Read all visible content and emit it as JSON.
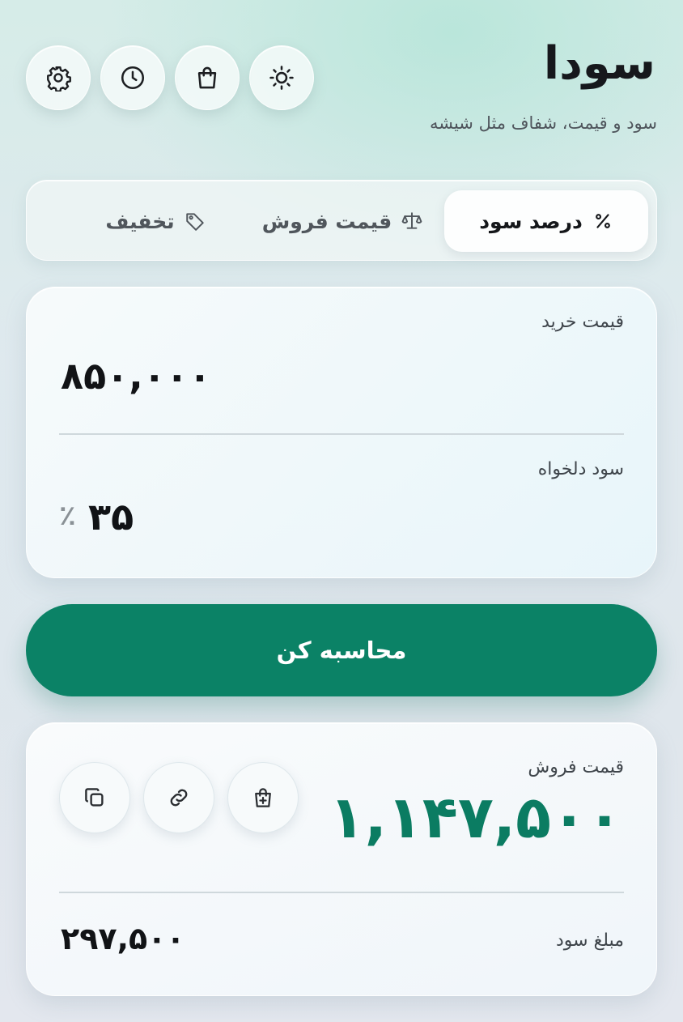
{
  "header": {
    "title": "سودا",
    "subtitle": "سود و قیمت، شفاف مثل شیشه",
    "icons": [
      "sun-icon",
      "shopping-bag-icon",
      "clock-icon",
      "gear-icon"
    ]
  },
  "tabs": [
    {
      "label": "درصد سود",
      "icon": "percent-icon",
      "active": true
    },
    {
      "label": "قیمت فروش",
      "icon": "scale-icon",
      "active": false
    },
    {
      "label": "تخفیف",
      "icon": "tag-icon",
      "active": false
    }
  ],
  "inputs": {
    "purchase_label": "قیمت خرید",
    "purchase_value": "۸۵۰,۰۰۰",
    "profit_label": "سود دلخواه",
    "profit_value": "۳۵",
    "percent_symbol": "٪"
  },
  "calculate_label": "محاسبه کن",
  "result": {
    "sale_label": "قیمت فروش",
    "sale_value": "۱,۱۴۷,۵۰۰",
    "profit_amount_label": "مبلغ سود",
    "profit_amount_value": "۲۹۷,۵۰۰",
    "actions": [
      "bag-plus-icon",
      "link-icon",
      "copy-icon"
    ]
  },
  "colors": {
    "accent": "#0b8266",
    "result_text": "#0b7c62"
  }
}
